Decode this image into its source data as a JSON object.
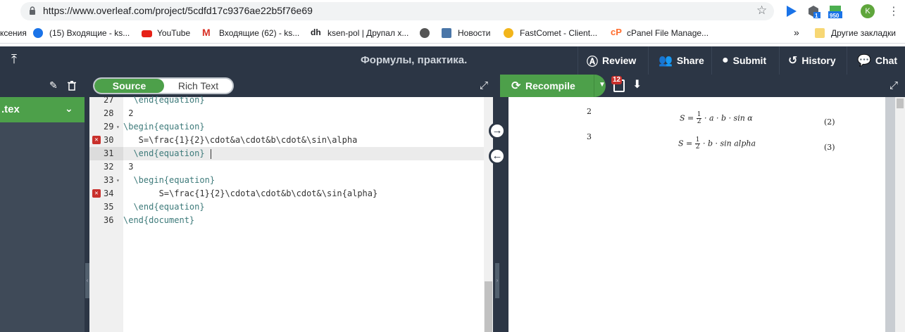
{
  "browser": {
    "url": "https://www.overleaf.com/project/5cdfd17c9376ae22b5f76e69",
    "badge_ext1": "1",
    "badge_ext2": "950",
    "avatar": "K"
  },
  "bookmarks": {
    "items": [
      {
        "label": "ксения"
      },
      {
        "label": "(15) Входящие - ks..."
      },
      {
        "label": "YouTube"
      },
      {
        "label": "Входящие (62) - ks..."
      },
      {
        "label": "ksen-pol | Друпал х..."
      },
      {
        "label": "Новости"
      },
      {
        "label": "FastComet - Client..."
      },
      {
        "label": "cPanel File Manage..."
      }
    ],
    "more": "»",
    "other": "Другие закладки"
  },
  "toolbar": {
    "title": "Формулы, практика.",
    "review": "Review",
    "share": "Share",
    "submit": "Submit",
    "history": "History",
    "chat": "Chat"
  },
  "editor_toggle": {
    "source": "Source",
    "rich": "Rich Text"
  },
  "pdf_toolbar": {
    "recompile": "Recompile",
    "log_count": "12"
  },
  "file_tree": {
    "selected": ".tex"
  },
  "editor": {
    "lines": [
      {
        "num": "27",
        "fold": false,
        "error": false,
        "active": false
      },
      {
        "num": "28",
        "fold": false,
        "error": false,
        "active": false
      },
      {
        "num": "29",
        "fold": true,
        "error": false,
        "active": false
      },
      {
        "num": "30",
        "fold": false,
        "error": true,
        "active": false
      },
      {
        "num": "31",
        "fold": false,
        "error": false,
        "active": true
      },
      {
        "num": "32",
        "fold": false,
        "error": false,
        "active": false
      },
      {
        "num": "33",
        "fold": true,
        "error": false,
        "active": false
      },
      {
        "num": "34",
        "fold": false,
        "error": true,
        "active": false
      },
      {
        "num": "35",
        "fold": false,
        "error": false,
        "active": false
      },
      {
        "num": "36",
        "fold": false,
        "error": false,
        "active": false
      }
    ],
    "code": {
      "l27": "  \\end{equation}",
      "l28": " 2",
      "l29": "\\begin{equation}",
      "l30": "   S=\\frac{1}{2}\\cdot&a\\cdot&b\\cdot&\\sin\\alpha",
      "l31": "  \\end{equation}",
      "l32": " 3",
      "l33": "  \\begin{equation}",
      "l34": "       S=\\frac{1}{2}\\cdota\\cdot&b\\cdot&\\sin{alpha}",
      "l35": "  \\end{equation}",
      "l36": "\\end{document}"
    }
  },
  "pdf": {
    "num2": "2",
    "num3": "3",
    "eq2_lhs": "S =",
    "eq2_num": "1",
    "eq2_den": "2",
    "eq2_rhs": "· a · b · sin α",
    "eq2_tag": "(2)",
    "eq3_lhs": "S =",
    "eq3_num": "1",
    "eq3_den": "2",
    "eq3_rhs": "· b · sin alpha",
    "eq3_tag": "(3)"
  }
}
